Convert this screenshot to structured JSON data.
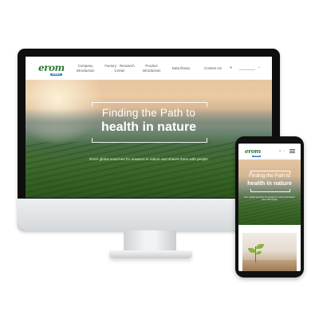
{
  "desktop": {
    "logo": {
      "word": "erom",
      "tag": "GREEN"
    },
    "nav": [
      {
        "label": "Company\nIntroduction"
      },
      {
        "label": "Factory · Research\nCenter"
      },
      {
        "label": "Product\nIntroduction"
      },
      {
        "label": "Data library"
      },
      {
        "label": "Contact Us"
      }
    ],
    "language_icon": "globe-icon",
    "hero": {
      "title_line1": "Finding the Path to",
      "title_line2": "health in nature",
      "subtitle": "Erom global searches for answers in nature and shares them with people"
    }
  },
  "mobile": {
    "logo": {
      "word": "erom",
      "tag": "GREEN"
    },
    "hero": {
      "title_line1": "Finding the Path to",
      "title_line2": "health in nature",
      "subtitle": "Erom global searches for answers in nature and shares them with people"
    },
    "image_icon": "seedling-icon"
  },
  "colors": {
    "brand_green": "#2e7d32",
    "brand_tag_blue": "#2b7bd0"
  }
}
